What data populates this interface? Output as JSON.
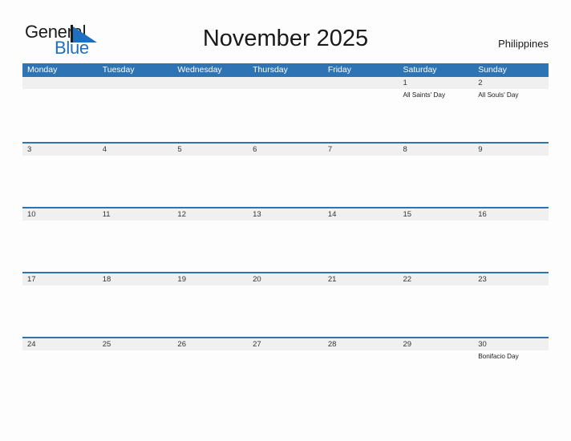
{
  "brand": {
    "name_part1": "General",
    "name_part2": "Blue",
    "flag_icon": "flag-triangle-icon"
  },
  "header": {
    "title": "November 2025",
    "region": "Philippines"
  },
  "colors": {
    "header_blue": "#2E74B5",
    "band_gray": "#F0F0F0",
    "brand_blue": "#1F6FC0",
    "page_background": "#FDFDFD",
    "text_dark": "#1A1A1A"
  },
  "weekdays": [
    "Monday",
    "Tuesday",
    "Wednesday",
    "Thursday",
    "Friday",
    "Saturday",
    "Sunday"
  ],
  "weeks": [
    {
      "days": [
        {
          "date": "",
          "events": []
        },
        {
          "date": "",
          "events": []
        },
        {
          "date": "",
          "events": []
        },
        {
          "date": "",
          "events": []
        },
        {
          "date": "",
          "events": []
        },
        {
          "date": "1",
          "events": [
            "All Saints' Day"
          ]
        },
        {
          "date": "2",
          "events": [
            "All Souls' Day"
          ]
        }
      ]
    },
    {
      "days": [
        {
          "date": "3",
          "events": []
        },
        {
          "date": "4",
          "events": []
        },
        {
          "date": "5",
          "events": []
        },
        {
          "date": "6",
          "events": []
        },
        {
          "date": "7",
          "events": []
        },
        {
          "date": "8",
          "events": []
        },
        {
          "date": "9",
          "events": []
        }
      ]
    },
    {
      "days": [
        {
          "date": "10",
          "events": []
        },
        {
          "date": "11",
          "events": []
        },
        {
          "date": "12",
          "events": []
        },
        {
          "date": "13",
          "events": []
        },
        {
          "date": "14",
          "events": []
        },
        {
          "date": "15",
          "events": []
        },
        {
          "date": "16",
          "events": []
        }
      ]
    },
    {
      "days": [
        {
          "date": "17",
          "events": []
        },
        {
          "date": "18",
          "events": []
        },
        {
          "date": "19",
          "events": []
        },
        {
          "date": "20",
          "events": []
        },
        {
          "date": "21",
          "events": []
        },
        {
          "date": "22",
          "events": []
        },
        {
          "date": "23",
          "events": []
        }
      ]
    },
    {
      "days": [
        {
          "date": "24",
          "events": []
        },
        {
          "date": "25",
          "events": []
        },
        {
          "date": "26",
          "events": []
        },
        {
          "date": "27",
          "events": []
        },
        {
          "date": "28",
          "events": []
        },
        {
          "date": "29",
          "events": []
        },
        {
          "date": "30",
          "events": [
            "Bonifacio Day"
          ]
        }
      ]
    }
  ]
}
